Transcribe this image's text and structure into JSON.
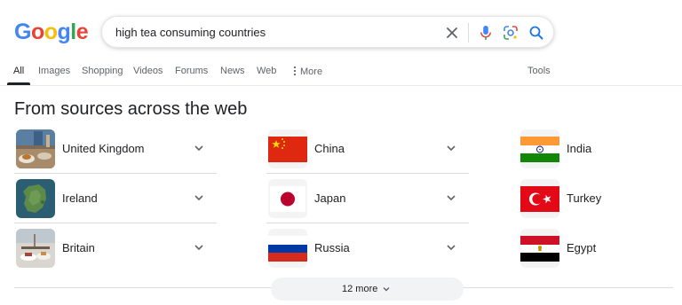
{
  "logo": {
    "letters": [
      "G",
      "o",
      "o",
      "g",
      "l",
      "e"
    ],
    "colors": [
      "#4285F4",
      "#EA4335",
      "#FBBC05",
      "#4285F4",
      "#34A853",
      "#EA4335"
    ]
  },
  "search": {
    "query": "high tea consuming countries"
  },
  "tabs": [
    {
      "label": "All",
      "active": true
    },
    {
      "label": "Images"
    },
    {
      "label": "Shopping"
    },
    {
      "label": "Videos"
    },
    {
      "label": "Forums"
    },
    {
      "label": "News"
    },
    {
      "label": "Web"
    },
    {
      "label": "More",
      "icon": "vertical-dots-icon"
    }
  ],
  "tools_label": "Tools",
  "section": {
    "title": "From sources across the web"
  },
  "results": [
    {
      "label": "United Kingdom",
      "thumb": "photo-tea-table"
    },
    {
      "label": "China",
      "thumb": "flag-china"
    },
    {
      "label": "India",
      "thumb": "flag-india"
    },
    {
      "label": "Ireland",
      "thumb": "photo-ireland-map"
    },
    {
      "label": "Japan",
      "thumb": "flag-japan"
    },
    {
      "label": "Turkey",
      "thumb": "flag-turkey"
    },
    {
      "label": "Britain",
      "thumb": "photo-afternoon-tea"
    },
    {
      "label": "Russia",
      "thumb": "flag-russia"
    },
    {
      "label": "Egypt",
      "thumb": "flag-egypt"
    }
  ],
  "more_button": {
    "label": "12 more"
  },
  "colors": {
    "blue": "#1a73e8",
    "mic_blue": "#4285F4",
    "mic_red": "#EA4335",
    "text": "#202124",
    "muted": "#5f6368"
  }
}
